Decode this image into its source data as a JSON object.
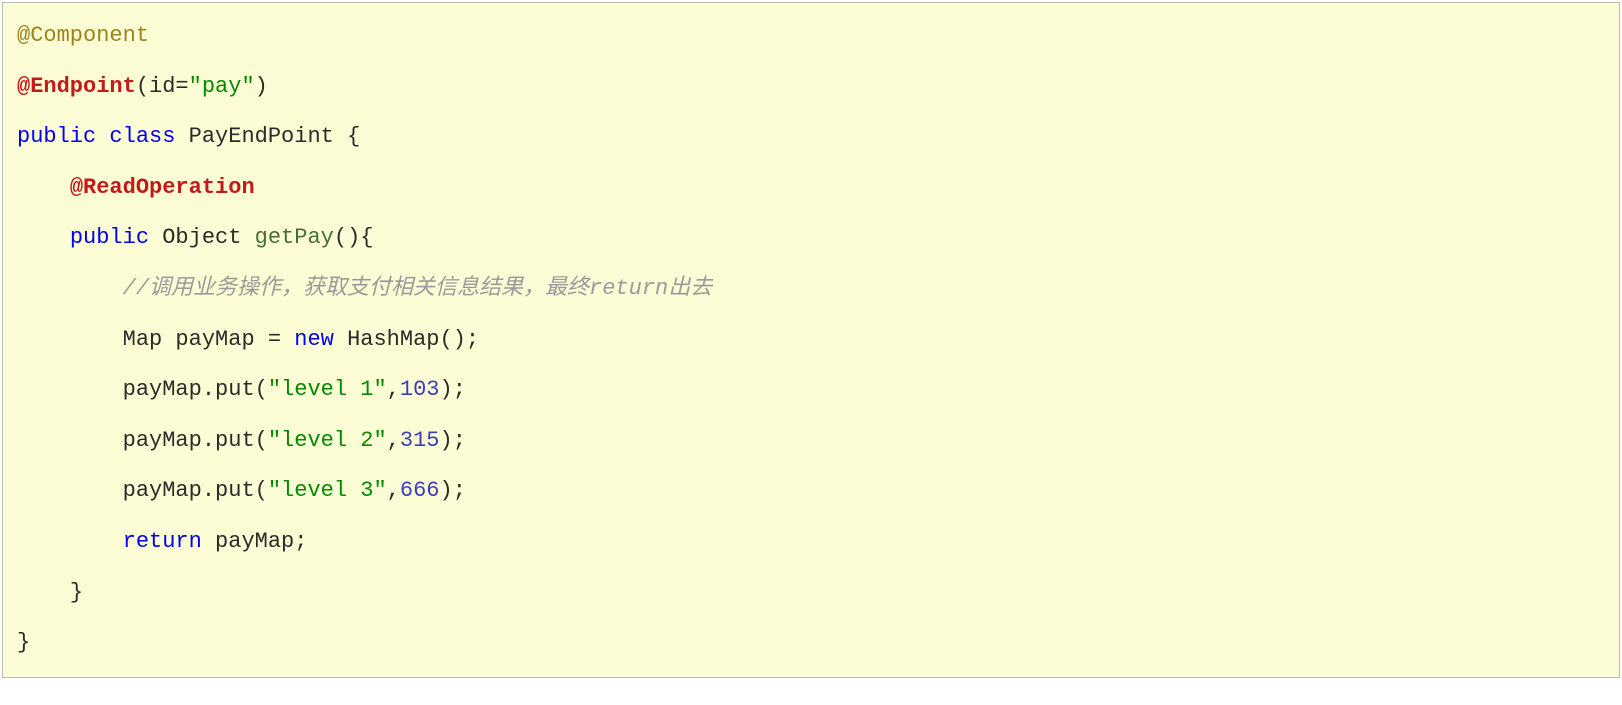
{
  "code": {
    "line1": {
      "annotation": "@Component"
    },
    "line2": {
      "annotation": "@Endpoint",
      "paren_open": "(id=",
      "string": "\"pay\"",
      "paren_close": ")"
    },
    "line3": {
      "kw_public": "public",
      "kw_class": "class",
      "classname": " PayEndPoint {"
    },
    "line4": {
      "indent": "    ",
      "annotation": "@ReadOperation"
    },
    "line5": {
      "indent": "    ",
      "kw_public": "public",
      "type": " Object ",
      "method": "getPay",
      "parens": "(){"
    },
    "line6": {
      "indent": "        ",
      "comment": "//调用业务操作，获取支付相关信息结果，最终return出去"
    },
    "line7": {
      "indent": "        ",
      "pre": "Map payMap = ",
      "kw_new": "new",
      "post": " HashMap();"
    },
    "line8": {
      "indent": "        ",
      "pre": "payMap.put(",
      "string": "\"level 1\"",
      "comma": ",",
      "number": "103",
      "post": ");"
    },
    "line9": {
      "indent": "        ",
      "pre": "payMap.put(",
      "string": "\"level 2\"",
      "comma": ",",
      "number": "315",
      "post": ");"
    },
    "line10": {
      "indent": "        ",
      "pre": "payMap.put(",
      "string": "\"level 3\"",
      "comma": ",",
      "number": "666",
      "post": ");"
    },
    "line11": {
      "indent": "        ",
      "kw_return": "return",
      "post": " payMap;"
    },
    "line12": {
      "indent": "    ",
      "brace": "}"
    },
    "line13": {
      "brace": "}"
    }
  }
}
